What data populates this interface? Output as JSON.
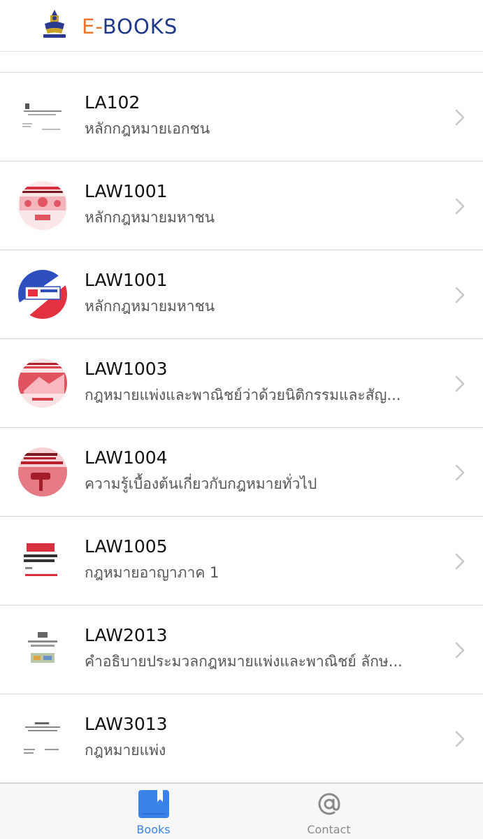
{
  "header": {
    "title_prefix": "E-",
    "title_main": "BOOKS",
    "logo_icon": "university-emblem-icon",
    "colors": {
      "title": "#1f3a8a",
      "accent": "#e8772e"
    }
  },
  "books": [
    {
      "code": "LA102",
      "name": "หลักกฎหมายเอกชน",
      "cover": "plain"
    },
    {
      "code": "LAW1001",
      "name": "หลักกฎหมายมหาชน",
      "cover": "red-pattern"
    },
    {
      "code": "LAW1001",
      "name": "หลักกฎหมายมหาชน",
      "cover": "blue-red"
    },
    {
      "code": "LAW1003",
      "name": "กฎหมายแพ่งและพาณิชย์ว่าด้วยนิติกรรมและสัญ...",
      "cover": "red-photo"
    },
    {
      "code": "LAW1004",
      "name": "ความรู้เบื้องต้นเกี่ยวกับกฎหมายทั่วไป",
      "cover": "red-gavel"
    },
    {
      "code": "LAW1005",
      "name": "กฎหมายอาญาภาค 1",
      "cover": "red-title"
    },
    {
      "code": "LAW2013",
      "name": "คำอธิบายประมวลกฎหมายแพ่งและพาณิชย์ ลักษ...",
      "cover": "plain-image"
    },
    {
      "code": "LAW3013",
      "name": "กฎหมายแพ่ง",
      "cover": "plain"
    }
  ],
  "tabs": [
    {
      "label": "Books",
      "icon": "book-icon",
      "active": true
    },
    {
      "label": "Contact",
      "icon": "at-sign-icon",
      "active": false
    }
  ],
  "colors": {
    "active_tab": "#3b82e8",
    "inactive_tab": "#8a8a8a",
    "chevron": "#c7c7cc"
  }
}
